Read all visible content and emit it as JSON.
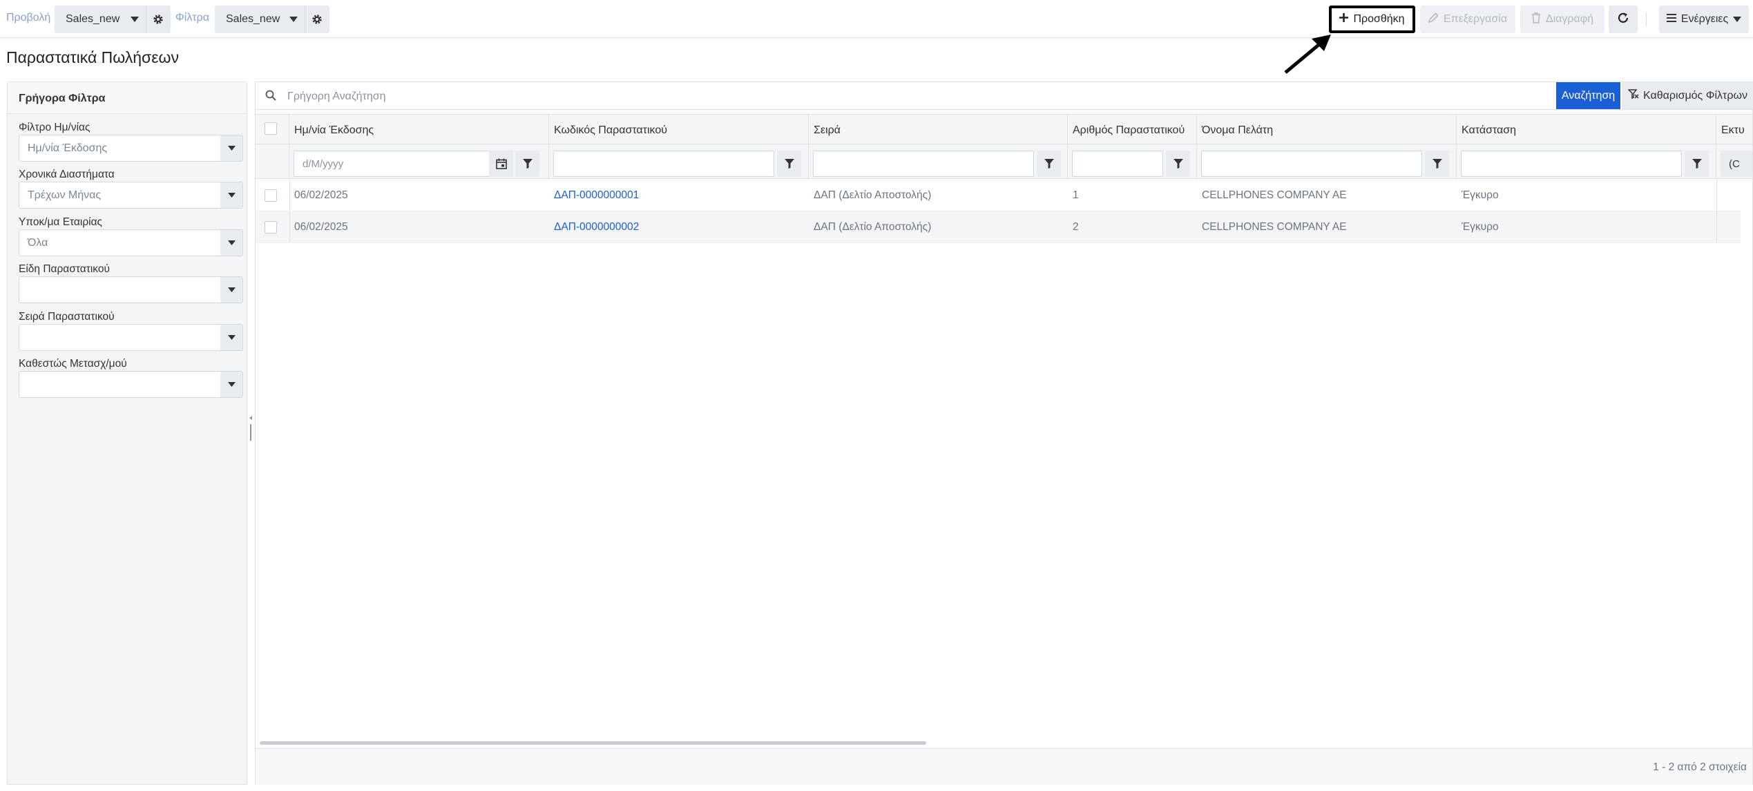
{
  "toolbar": {
    "view_label": "Προβολή",
    "view_value": "Sales_new",
    "filter_label": "Φίλτρα",
    "filter_value": "Sales_new",
    "add_label": "Προσθήκη",
    "edit_label": "Επεξεργασία",
    "delete_label": "Διαγραφή",
    "actions_label": "Ενέργειες"
  },
  "page": {
    "title": "Παραστατικά Πωλήσεων"
  },
  "quick_filters": {
    "title": "Γρήγορα Φίλτρα",
    "fields": [
      {
        "label": "Φίλτρο Ημ/νίας",
        "value": "Ημ/νία Έκδοσης"
      },
      {
        "label": "Χρονικά Διαστήματα",
        "value": "Τρέχων Μήνας"
      },
      {
        "label": "Υποκ/μα Εταιρίας",
        "value": "Όλα"
      },
      {
        "label": "Είδη Παραστατικού",
        "value": ""
      },
      {
        "label": "Σειρά Παραστατικού",
        "value": ""
      },
      {
        "label": "Καθεστώς Μετασχ/μού",
        "value": ""
      }
    ]
  },
  "search": {
    "placeholder": "Γρήγορη Αναζήτηση",
    "search_button": "Αναζήτηση",
    "clear_button": "Καθαρισμός Φίλτρων"
  },
  "table": {
    "columns": [
      "Ημ/νία Έκδοσης",
      "Κωδικός Παραστατικού",
      "Σειρά",
      "Αριθμός Παραστατικού",
      "Όνομα Πελάτη",
      "Κατάσταση",
      "Εκτυ"
    ],
    "date_placeholder": "d/M/yyyy",
    "partial_filter_text": "(C",
    "rows": [
      {
        "date": "06/02/2025",
        "code": "ΔΑΠ-0000000001",
        "series": "ΔΑΠ (Δελτίο Αποστολής)",
        "number": "1",
        "customer": "CELLPHONES COMPANY AE",
        "status": "Έγκυρο"
      },
      {
        "date": "06/02/2025",
        "code": "ΔΑΠ-0000000002",
        "series": "ΔΑΠ (Δελτίο Αποστολής)",
        "number": "2",
        "customer": "CELLPHONES COMPANY AE",
        "status": "Έγκυρο"
      }
    ]
  },
  "footer": {
    "pager_info": "1 - 2 από 2 στοιχεία"
  },
  "colors": {
    "accent": "#1a5fd6",
    "panel_bg": "#f4f5f7",
    "button_bg": "#e8ecf1"
  }
}
